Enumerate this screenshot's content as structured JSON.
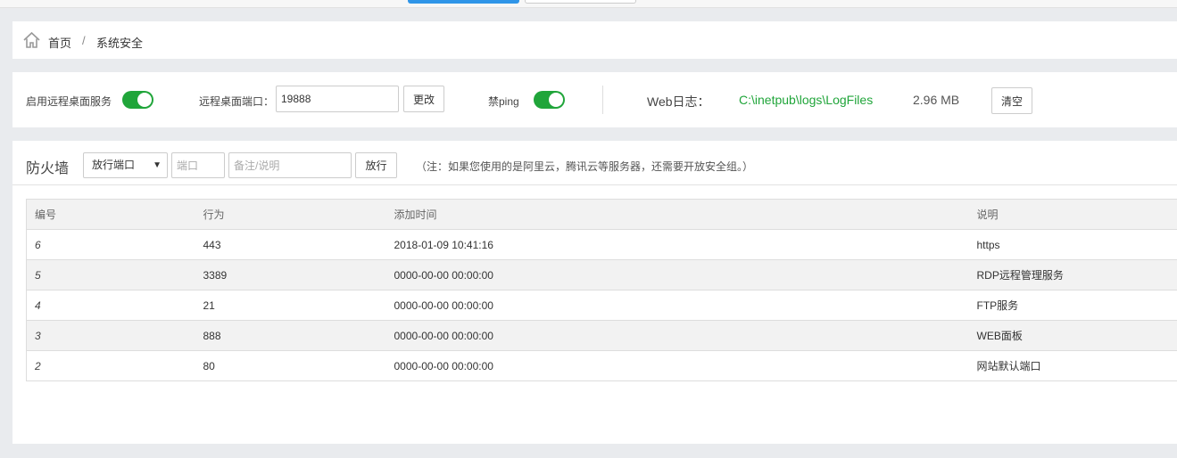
{
  "breadcrumb": {
    "home": "首页",
    "separator": "/",
    "current": "系统安全"
  },
  "settings": {
    "rdp_service_label": "启用远程桌面服务",
    "rdp_service_enabled": true,
    "rdp_port_label": "远程桌面端口：",
    "rdp_port_value": "19888",
    "change_button": "更改",
    "ping_label": "禁ping",
    "ping_disabled": true,
    "web_log_label": "Web日志：",
    "web_log_path": "C:\\inetpub\\logs\\LogFiles",
    "web_log_size": "2.96 MB",
    "clear_button": "清空"
  },
  "firewall": {
    "title": "防火墙",
    "action_select": "放行端口",
    "port_placeholder": "端口",
    "note_placeholder": "备注/说明",
    "allow_button": "放行",
    "notice": "（注：如果您使用的是阿里云，腾讯云等服务器，还需要开放安全组。）",
    "columns": [
      "编号",
      "行为",
      "添加时间",
      "说明"
    ],
    "rows": [
      {
        "id": "6",
        "action": "443",
        "time": "2018-01-09 10:41:16",
        "desc": "https"
      },
      {
        "id": "5",
        "action": "3389",
        "time": "0000-00-00 00:00:00",
        "desc": "RDP远程管理服务"
      },
      {
        "id": "4",
        "action": "21",
        "time": "0000-00-00 00:00:00",
        "desc": "FTP服务"
      },
      {
        "id": "3",
        "action": "888",
        "time": "0000-00-00 00:00:00",
        "desc": "WEB面板"
      },
      {
        "id": "2",
        "action": "80",
        "time": "0000-00-00 00:00:00",
        "desc": "网站默认端口"
      }
    ]
  },
  "colors": {
    "accent_green": "#20a53a",
    "accent_blue": "#2f95e8",
    "page_bg": "#e9ebee"
  }
}
